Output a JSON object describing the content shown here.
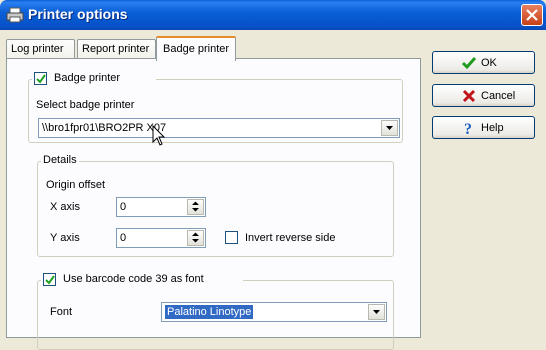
{
  "window": {
    "title": "Printer options"
  },
  "tabs": [
    {
      "label": "Log printer"
    },
    {
      "label": "Report printer"
    },
    {
      "label": "Badge printer"
    }
  ],
  "buttons": {
    "ok": "OK",
    "cancel": "Cancel",
    "help": "Help"
  },
  "badge_group": {
    "checkbox_label": "Badge printer",
    "checked": true,
    "select_label": "Select badge printer",
    "printer_value": "\\\\bro1fpr01\\BRO2PR X07"
  },
  "details": {
    "legend": "Details",
    "origin_offset": "Origin offset",
    "x_label": "X axis",
    "x_value": "0",
    "y_label": "Y axis",
    "y_value": "0",
    "invert_label": "Invert reverse side",
    "invert_checked": false
  },
  "barcode": {
    "checkbox_label": "Use barcode code 39 as font",
    "checked": true,
    "font_label": "Font",
    "font_value": "Palatino Linotype"
  },
  "colors": {
    "titlebar": "#0b5fd8",
    "selection": "#316ac5",
    "active_tab_accent": "#e68b2c"
  }
}
